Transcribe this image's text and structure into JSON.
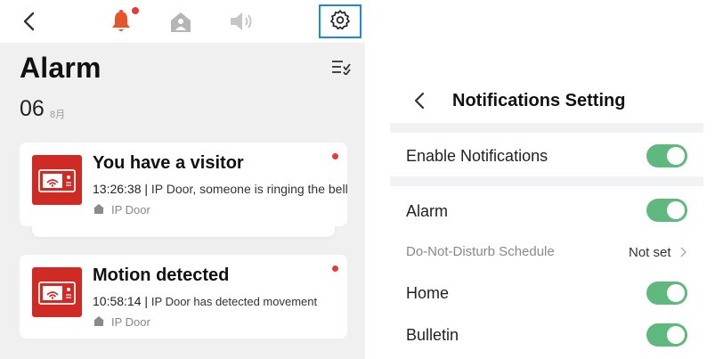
{
  "topbar": {
    "icons": [
      "back-arrow-icon",
      "bell-icon",
      "home-icon",
      "speaker-icon",
      "gear-icon"
    ],
    "bell_badge_color": "#e23b3b",
    "gear_highlight_color": "#1e8ad0"
  },
  "alarm": {
    "title": "Alarm",
    "date_day": "06",
    "date_month": "8月",
    "events": [
      {
        "title": "You have a visitor",
        "time": "13:26:38",
        "message": "IP Door, someone is ringing the bell",
        "location": "IP Door",
        "unread": true
      },
      {
        "title": "Motion detected",
        "time": "10:58:14",
        "message": "IP Door has detected movement",
        "location": "IP Door",
        "unread": true
      }
    ],
    "thumb_color": "#cf2a23"
  },
  "settings": {
    "title": "Notifications Setting",
    "enable_notifications": {
      "label": "Enable Notifications",
      "on": true
    },
    "alarm": {
      "label": "Alarm",
      "on": true
    },
    "dnd": {
      "label": "Do-Not-Disturb Schedule",
      "value": "Not set"
    },
    "home": {
      "label": "Home",
      "on": true
    },
    "bulletin": {
      "label": "Bulletin",
      "on": true
    },
    "toggle_color": "#5fb87e"
  }
}
